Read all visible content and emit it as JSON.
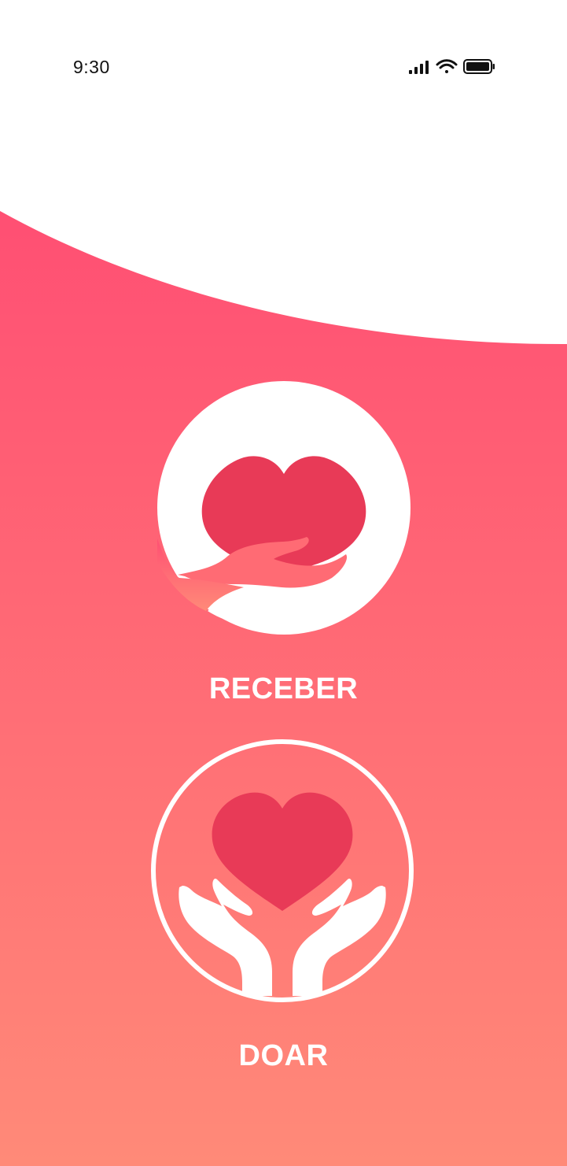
{
  "status_bar": {
    "time": "9:30",
    "icons": [
      "cellular-signal-icon",
      "wifi-icon",
      "battery-icon"
    ]
  },
  "colors": {
    "gradient_top": "#FF4F73",
    "gradient_bottom": "#FF8A78",
    "heart": "#E83A57",
    "hand_receber": "#FF6B74",
    "white": "#FFFFFF"
  },
  "options": {
    "receber": {
      "label": "RECEBER",
      "icon": "hand-holding-heart-icon"
    },
    "doar": {
      "label": "DOAR",
      "icon": "hands-giving-heart-icon"
    }
  }
}
